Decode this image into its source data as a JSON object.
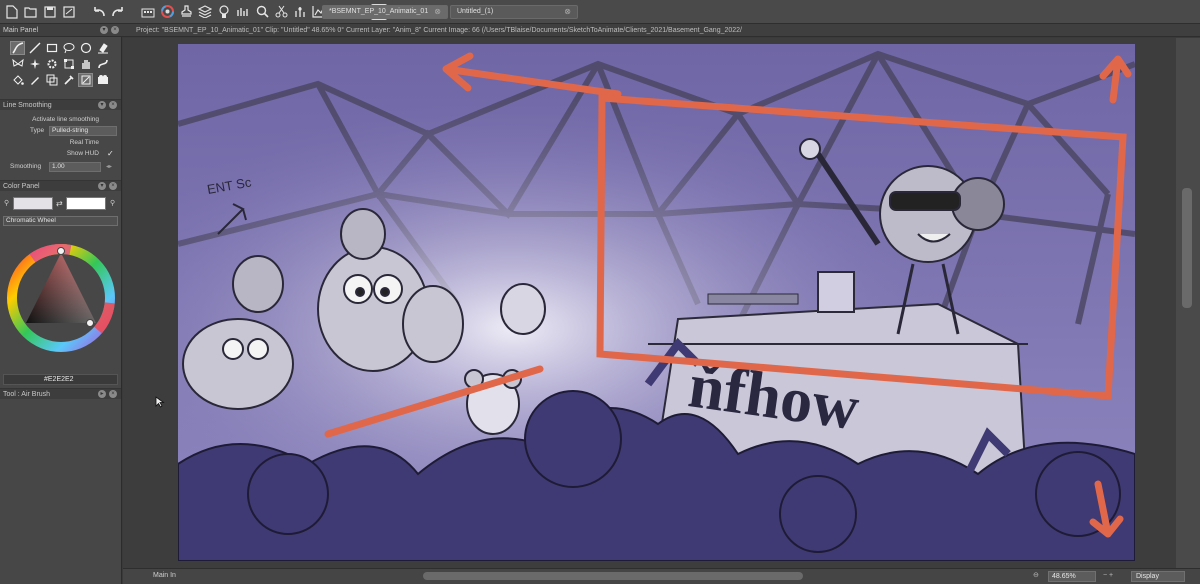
{
  "document_tabs": [
    {
      "label": "*BSEMNT_EP_10_Animatic_01",
      "active": true
    },
    {
      "label": "Untitled_(1)",
      "active": false
    }
  ],
  "toolbar_icons": [
    "new-file-icon",
    "open-file-icon",
    "save-icon",
    "save-as-icon",
    "undo-icon",
    "redo-icon",
    "toolbox-icon",
    "color-wheel-icon",
    "stamp-icon",
    "layers-icon",
    "bulb-icon",
    "brush-preset-icon",
    "magnify-icon",
    "scissors-icon",
    "adjust-icon",
    "chart-icon",
    "send-icon",
    "help-icon"
  ],
  "main_panel": {
    "title": "Main Panel",
    "tools": [
      "brush-stroke",
      "line",
      "rectangle",
      "lasso",
      "ellipse",
      "eraser-fill",
      "butterfly",
      "fill-sparkle",
      "gear",
      "transform",
      "hand",
      "smudge",
      "fill-bucket",
      "pen",
      "copy",
      "eyedropper",
      "mask",
      "film"
    ]
  },
  "line_smoothing": {
    "title": "Line Smoothing",
    "activate_label": "Activate line smoothing",
    "type_label": "Type",
    "type_value": "Pulled-string",
    "real_time_label": "Real Time",
    "show_hud_label": "Show HUD",
    "show_hud_checked": "✓",
    "smoothing_label": "Smoothing",
    "smoothing_value": "1.00"
  },
  "color_panel": {
    "title": "Color Panel",
    "mode": "Chromatic Wheel",
    "hex": "#E2E2E2",
    "primary_color": "#e4e2e6",
    "secondary_color": "#ffffff"
  },
  "tool_section": {
    "title": "Tool : Air Brush"
  },
  "info_bar": "Project: \"BSEMNT_EP_10_Animatic_01\"  Clip: \"Untitled\"  48.65%  0°  Current Layer: \"Anim_8\"  Current Image: 66 (/Users/TBlaise/Documents/SketchToAnimate/Clients_2021/Basement_Gang_2022/",
  "canvas": {
    "sign_text": "ňfhow",
    "annotation_text": "ENT Sc",
    "annotation_color": "#e0674a",
    "tint_color": "#6b62a3"
  },
  "status": {
    "zoom": "48.65%",
    "display": "Display",
    "bottom_left": "Main In"
  }
}
